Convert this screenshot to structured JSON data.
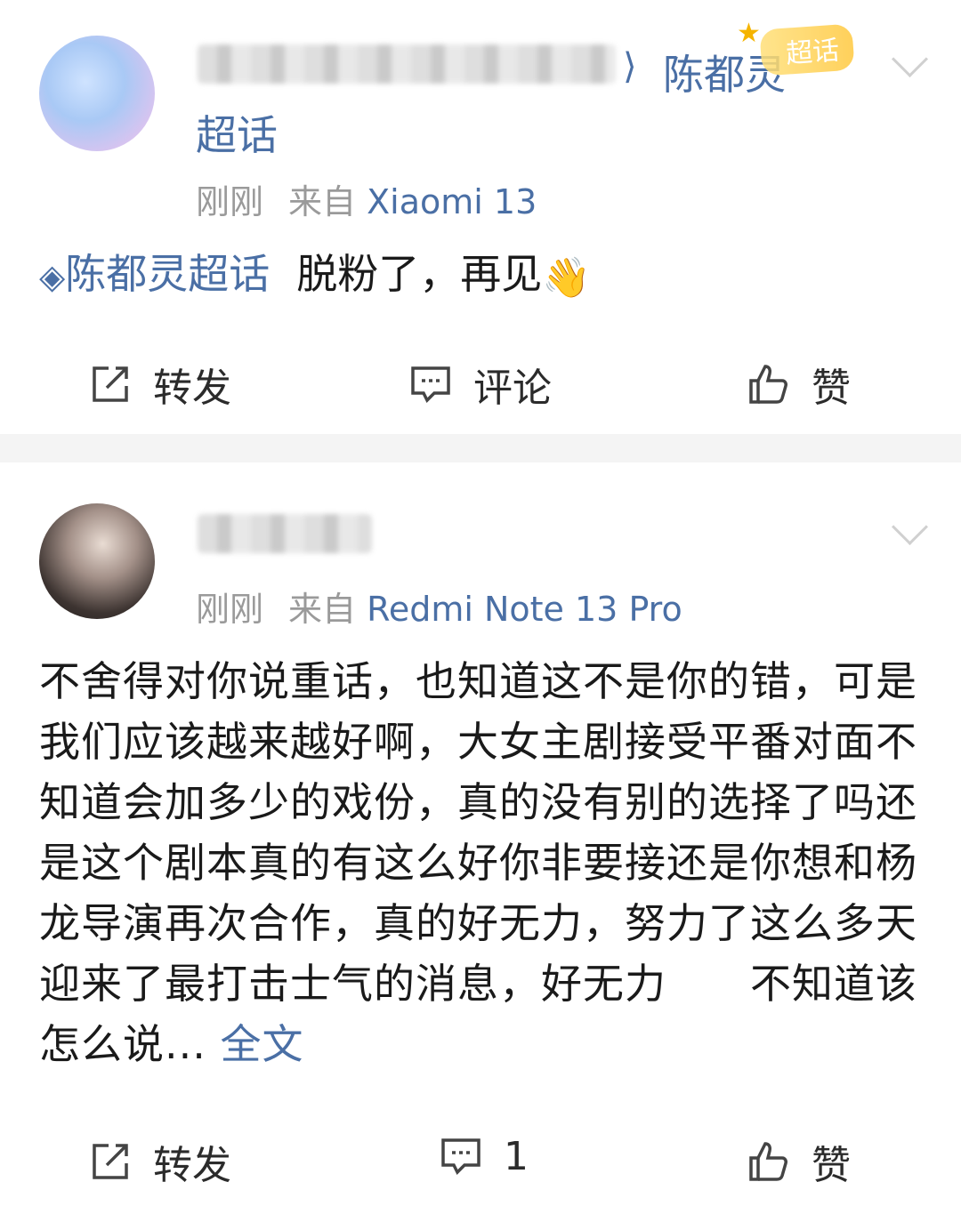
{
  "post1": {
    "avatar": "anime-avatar",
    "topic_arrow": "⟩",
    "topic_name": "陈都灵",
    "topic_name_wrap": "超话",
    "badge_label": "超话",
    "meta": {
      "time": "刚刚",
      "from": "来自",
      "device": "Xiaomi 13"
    },
    "content": {
      "tag": "陈都灵超话",
      "text": "脱粉了，再见",
      "emoji": "👋"
    },
    "actions": {
      "repost": "转发",
      "comment": "评论",
      "like": "赞"
    }
  },
  "post2": {
    "avatar": "photo-avatar",
    "meta": {
      "time": "刚刚",
      "from": "来自",
      "device": "Redmi Note 13 Pro"
    },
    "content": {
      "text": "不舍得对你说重话，也知道这不是你的错，可是我们应该越来越好啊，大女主剧接受平番对面不知道会加多少的戏份，真的没有别的选择了吗还是这个剧本真的有这么好你非要接还是你想和杨龙导演再次合作，真的好无力，努力了这么多天迎来了最打击士气的消息，好无力　　不知道该怎么说...",
      "more": "全文"
    },
    "actions": {
      "repost": "转发",
      "comment_count": "1",
      "like": "赞"
    }
  },
  "colors": {
    "link": "#4a6fa5",
    "meta": "#9a9a9a",
    "separator": "#f4f4f4"
  }
}
